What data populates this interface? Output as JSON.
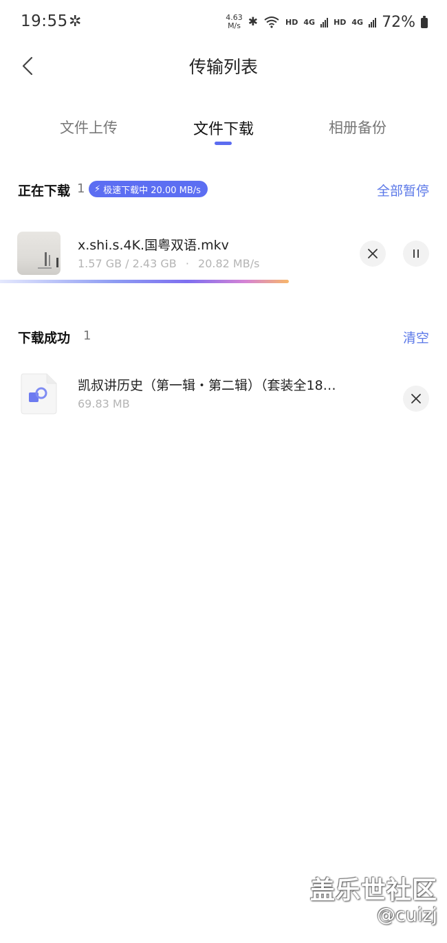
{
  "status_bar": {
    "time": "19:55",
    "net_speed_value": "4.63",
    "net_speed_unit": "M/s",
    "hd_label_1": "HD",
    "network_1": "4G",
    "hd_label_2": "HD",
    "network_2": "4G",
    "battery": "72%"
  },
  "header": {
    "title": "传输列表"
  },
  "tabs": [
    {
      "label": "文件上传",
      "active": false
    },
    {
      "label": "文件下载",
      "active": true
    },
    {
      "label": "相册备份",
      "active": false
    }
  ],
  "downloading": {
    "title": "正在下载",
    "count": "1",
    "speed_badge": "极速下载中 20.00 MB/s",
    "pause_all_label": "全部暂停",
    "item": {
      "name": "x.shi.s.4K.国粤双语.mkv",
      "size_progress": "1.57 GB / 2.43 GB",
      "separator": "·",
      "speed": "20.82 MB/s",
      "progress": 0.646
    }
  },
  "completed": {
    "title": "下载成功",
    "count": "1",
    "clear_label": "清空",
    "item": {
      "name": "凯叔讲历史（第一辑・第二辑）（套装全18…",
      "size": "69.83 MB"
    }
  },
  "watermark": {
    "site": "盖乐世社区",
    "user": "@cuizj"
  },
  "colors": {
    "accent": "#5b6cf0",
    "link": "#5b78e8",
    "meta_text": "#b4b4b4"
  }
}
